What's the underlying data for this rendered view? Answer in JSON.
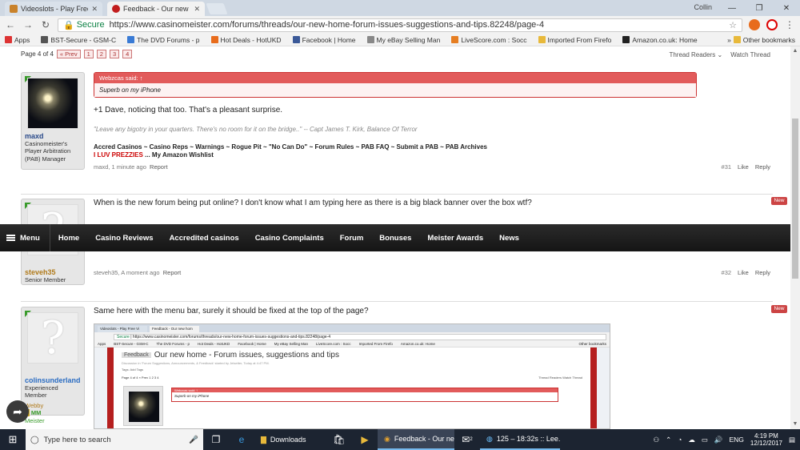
{
  "browser": {
    "tabs": [
      {
        "title": "Videoslots - Play Free Vi",
        "active": false,
        "favicon_color": "#c9822b"
      },
      {
        "title": "Feedback - Our new hom",
        "active": true,
        "favicon_color": "#c21d1d"
      }
    ],
    "profile_name": "Collin",
    "window_controls": [
      "—",
      "❐",
      "✕"
    ],
    "secure_label": "Secure",
    "url": "https://www.casinomeister.com/forums/threads/our-new-home-forum-issues-suggestions-and-tips.82248/page-4",
    "bookmarks": [
      {
        "label": "Apps",
        "color": "#d33"
      },
      {
        "label": "BST-Secure - GSM-C",
        "color": "#555"
      },
      {
        "label": "The DVD Forums - p",
        "color": "#3a7bd5"
      },
      {
        "label": "Hot Deals - HotUKD",
        "color": "#e86c1c"
      },
      {
        "label": "Facebook | Home",
        "color": "#3b5998"
      },
      {
        "label": "My eBay Selling Man",
        "color": "#888"
      },
      {
        "label": "LiveScore.com : Socc",
        "color": "#e67e22"
      },
      {
        "label": "Imported From Firefo",
        "color": "#e8b93b"
      },
      {
        "label": "Amazon.co.uk: Home",
        "color": "#222"
      }
    ],
    "bookmarks_overflow": "»",
    "other_bookmarks": "Other bookmarks"
  },
  "forum": {
    "page_indicator": "Page 4 of 4",
    "pages": [
      "« Prev",
      "1",
      "2",
      "3",
      "4"
    ],
    "thread_readers": "Thread Readers",
    "watch_thread": "Watch Thread",
    "posts": [
      {
        "username": "maxd",
        "user_title": "Casinomeister's Player Arbitration (PAB) Manager",
        "quote_author": "Webzcas said: ↑",
        "quote_text": "Superb on my iPhone",
        "message": "+1 Dave, noticing that too. That's a pleasant surprise.",
        "sig_quote": "\"Leave any bigotry in your quarters. There's no room for it on the bridge..\" -- Capt James T. Kirk, Balance Of Terror",
        "sig_line1": "Accred Casinos ~ Casino Reps ~ Warnings ~ Rogue Pit ~ \"No Can Do\" ~ Forum Rules ~ PAB FAQ ~ Submit a PAB ~ PAB Archives",
        "sig_line2_red": "I LUV PREZZIES",
        "sig_line2": "... My Amazon Wishlist",
        "meta_left": "maxd, 1 minute ago",
        "report": "Report",
        "post_no": "#31",
        "like": "Like",
        "reply": "Reply"
      },
      {
        "username": "steveh35",
        "user_title": "Senior Member",
        "message": "When is the new forum being put online? I don't know what I am typing here as there is a big black banner over the box wtf?",
        "meta_left": "steveh35, A moment ago",
        "report": "Report",
        "post_no": "#32",
        "like": "Like",
        "reply": "Reply",
        "badge": "New"
      },
      {
        "username": "colinsunderland",
        "user_title": "Experienced Member",
        "user_extra1": "Webby",
        "user_extra2": "MM",
        "user_extra3": "Meister",
        "message": "Same here with the menu bar, surely it should be fixed at the top of the page?",
        "badge": "New"
      }
    ]
  },
  "sitenav": {
    "menu": "Menu",
    "items": [
      "Home",
      "Casino Reviews",
      "Accredited casinos",
      "Casino Complaints",
      "Forum",
      "Bonuses",
      "Meister Awards",
      "News"
    ]
  },
  "embed": {
    "tabs": [
      "Videoslots - Play Free Vi",
      "Feedback - Our new hom"
    ],
    "secure": "Secure",
    "url": "https://www.casinomeister.com/forums/threads/our-new-home-forum-issues-suggestions-and-tips.82248/page-4",
    "bookmarks": [
      "Apps",
      "BST-Secure - GSM-C",
      "The DVD Forums - p",
      "Hot Deals - HotUKD",
      "Facebook | Home",
      "My eBay Selling Man",
      "LiveScore.com : Socc",
      "Imported From Firefo",
      "Amazon.co.uk: Home",
      "Other bookmarks"
    ],
    "feedback_label": "Feedback",
    "title": "Our new home - Forum issues, suggestions and tips",
    "subtitle": "Discussion in 'Forum Suggestions, Announcements, & Feedback' started by Jetsetter, Today at 4:47 PM.",
    "tags": "Tags: Add Tags",
    "pages": "Page 4 of 4   « Prev  1  2  3  4",
    "tools": "Thread Readers   Watch Thread",
    "quote_head": "Webzcas said: ↑",
    "quote_body": "Superb on my iPhone"
  },
  "taskbar": {
    "search_placeholder": "Type here to search",
    "apps": [
      {
        "label": "Downloads",
        "state": "normal"
      },
      {
        "label": "Feedback - Our ne...",
        "state": "active"
      },
      {
        "label": "125 – 18:32s :: Lee...",
        "state": "running"
      }
    ],
    "lang": "ENG",
    "time": "4:19 PM",
    "date": "12/12/2017",
    "notifications": "2"
  },
  "share_icon": "share-icon"
}
